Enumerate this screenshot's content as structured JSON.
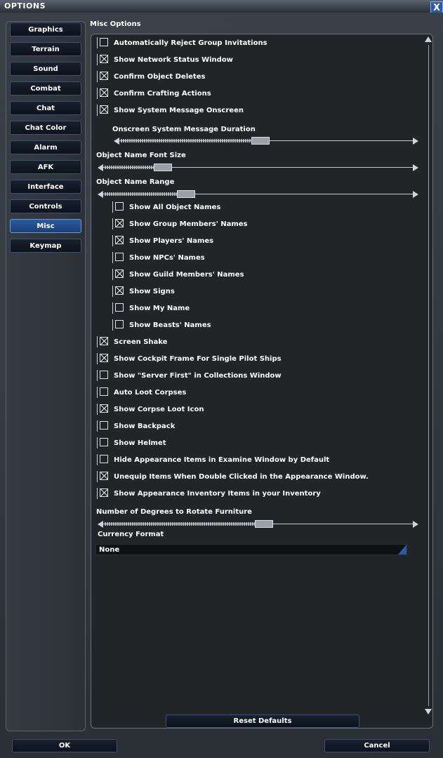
{
  "window": {
    "title": "OPTIONS",
    "close_label": "X"
  },
  "sidebar": {
    "items": [
      {
        "label": "Graphics",
        "active": false
      },
      {
        "label": "Terrain",
        "active": false
      },
      {
        "label": "Sound",
        "active": false
      },
      {
        "label": "Combat",
        "active": false
      },
      {
        "label": "Chat",
        "active": false
      },
      {
        "label": "Chat Color",
        "active": false
      },
      {
        "label": "Alarm",
        "active": false
      },
      {
        "label": "AFK",
        "active": false
      },
      {
        "label": "Interface",
        "active": false
      },
      {
        "label": "Controls",
        "active": false
      },
      {
        "label": "Misc",
        "active": true
      },
      {
        "label": "Keymap",
        "active": false
      }
    ]
  },
  "section_title": "Misc Options",
  "options": {
    "auto_reject": {
      "label": "Automatically Reject Group Invitations",
      "checked": false
    },
    "network_status": {
      "label": "Show Network Status Window",
      "checked": true
    },
    "confirm_deletes": {
      "label": "Confirm Object Deletes",
      "checked": true
    },
    "confirm_crafting": {
      "label": "Confirm Crafting Actions",
      "checked": true
    },
    "system_message": {
      "label": "Show System Message Onscreen",
      "checked": true
    },
    "all_object_names": {
      "label": "Show All Object Names",
      "checked": false
    },
    "group_members_names": {
      "label": "Show Group Members' Names",
      "checked": true
    },
    "players_names": {
      "label": "Show Players' Names",
      "checked": true
    },
    "npcs_names": {
      "label": "Show NPCs' Names",
      "checked": false
    },
    "guild_members_names": {
      "label": "Show Guild Members' Names",
      "checked": true
    },
    "signs": {
      "label": "Show Signs",
      "checked": true
    },
    "my_name": {
      "label": "Show My Name",
      "checked": false
    },
    "beasts_names": {
      "label": "Show Beasts' Names",
      "checked": false
    },
    "screen_shake": {
      "label": "Screen Shake",
      "checked": true
    },
    "cockpit_frame": {
      "label": "Show Cockpit Frame For Single Pilot Ships",
      "checked": true
    },
    "server_first": {
      "label": "Show \"Server First\" in Collections Window",
      "checked": false
    },
    "auto_loot": {
      "label": "Auto Loot Corpses",
      "checked": false
    },
    "corpse_loot_icon": {
      "label": "Show Corpse Loot Icon",
      "checked": true
    },
    "backpack": {
      "label": "Show Backpack",
      "checked": false
    },
    "helmet": {
      "label": "Show Helmet",
      "checked": false
    },
    "hide_appearance": {
      "label": "Hide Appearance Items in Examine Window by Default",
      "checked": false
    },
    "unequip_double_click": {
      "label": "Unequip Items When Double Clicked in the Appearance Window.",
      "checked": true
    },
    "appearance_inventory": {
      "label": "Show Appearance Inventory  Items in your Inventory",
      "checked": true
    }
  },
  "sliders": {
    "system_message_duration": {
      "label": "Onscreen System Message Duration",
      "value": 0.48
    },
    "object_name_font_size": {
      "label": "Object Name Font Size",
      "value": 0.17
    },
    "object_name_range": {
      "label": "Object Name Range",
      "value": 0.25
    },
    "rotate_furniture": {
      "label": "Number of Degrees to Rotate Furniture",
      "value": 0.52
    }
  },
  "currency": {
    "label": "Currency Format",
    "value": "None"
  },
  "buttons": {
    "reset": "Reset Defaults",
    "ok": "OK",
    "cancel": "Cancel"
  }
}
